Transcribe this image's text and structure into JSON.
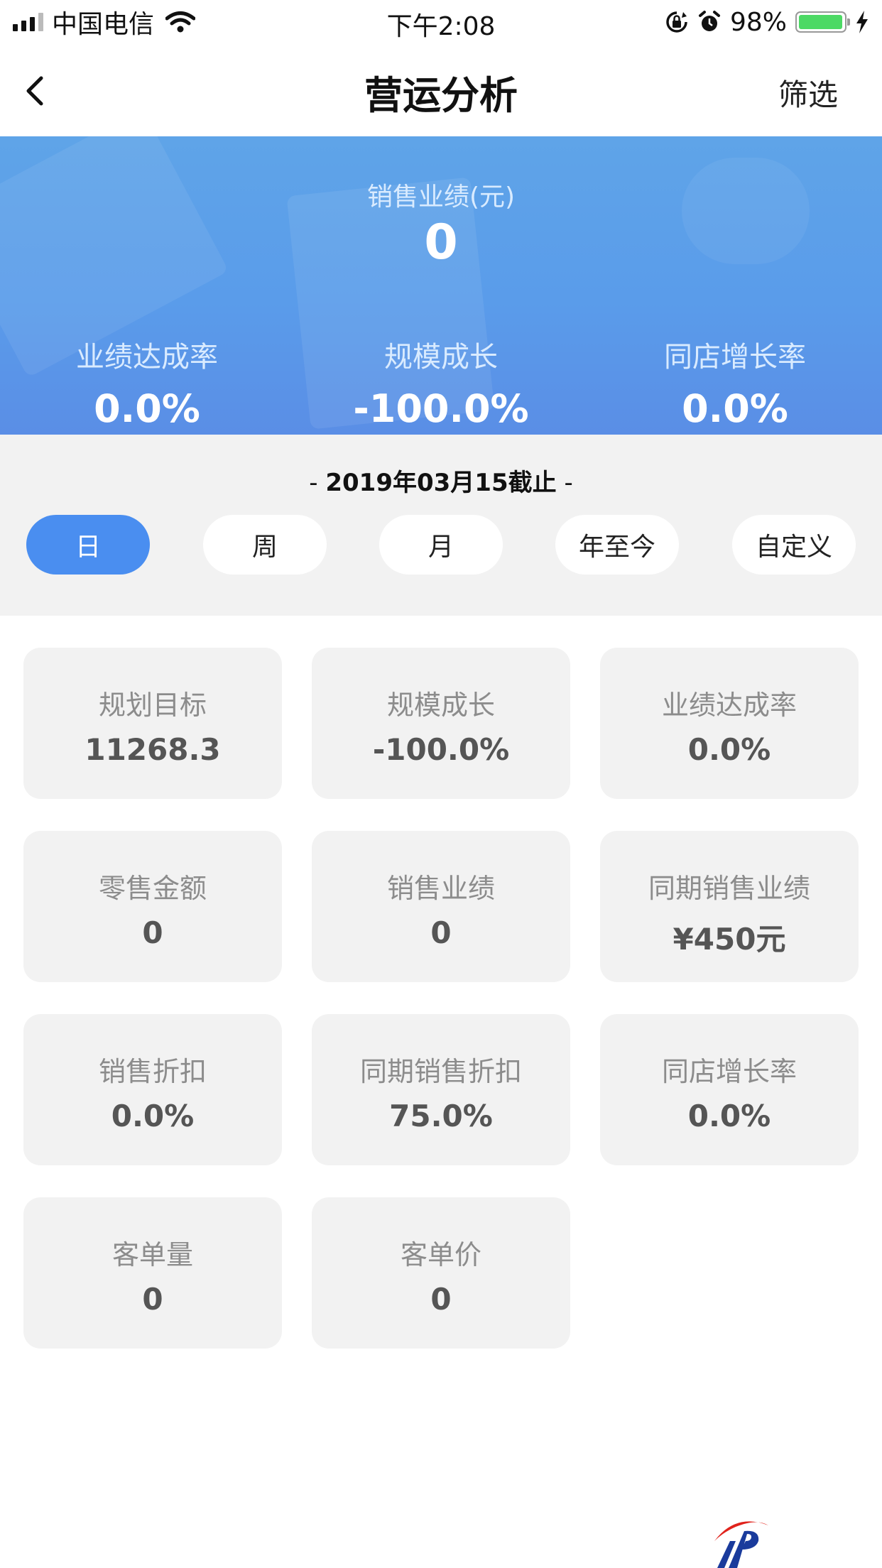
{
  "status_bar": {
    "carrier": "中国电信",
    "time": "下午2:08",
    "battery_percent": "98%",
    "battery_level": 0.98,
    "icons": [
      "signal-icon",
      "wifi-icon",
      "orientation-lock-icon",
      "alarm-icon",
      "battery-icon",
      "charging-icon"
    ]
  },
  "nav": {
    "title": "营运分析",
    "filter_label": "筛选",
    "back_icon": "chevron-left-icon"
  },
  "banner": {
    "label": "销售业绩(元)",
    "value": "0",
    "stats": [
      {
        "label": "业绩达成率",
        "value": "0.0%"
      },
      {
        "label": "规模成长",
        "value": "-100.0%"
      },
      {
        "label": "同店增长率",
        "value": "0.0%"
      }
    ]
  },
  "period": {
    "date_text": "2019年03月15截止",
    "dash": "-",
    "tabs": [
      {
        "label": "日",
        "active": true
      },
      {
        "label": "周",
        "active": false
      },
      {
        "label": "月",
        "active": false
      },
      {
        "label": "年至今",
        "active": false
      },
      {
        "label": "自定义",
        "active": false
      }
    ],
    "active_color": "#4a8ef0"
  },
  "metrics": [
    {
      "label": "规划目标",
      "value": "11268.3"
    },
    {
      "label": "规模成长",
      "value": "-100.0%"
    },
    {
      "label": "业绩达成率",
      "value": "0.0%"
    },
    {
      "label": "零售金额",
      "value": "0"
    },
    {
      "label": "销售业绩",
      "value": "0"
    },
    {
      "label": "同期销售业绩",
      "value": "¥450元"
    },
    {
      "label": "销售折扣",
      "value": "0.0%"
    },
    {
      "label": "同期销售折扣",
      "value": "75.0%"
    },
    {
      "label": "同店增长率",
      "value": "0.0%"
    },
    {
      "label": "客单量",
      "value": "0"
    },
    {
      "label": "客单价",
      "value": "0"
    }
  ],
  "colors": {
    "banner_top": "#5fa4e8",
    "banner_bottom": "#5a8ee6",
    "card_bg": "#f2f2f2",
    "logo_red": "#e0231c",
    "logo_blue": "#1a3b9c"
  }
}
